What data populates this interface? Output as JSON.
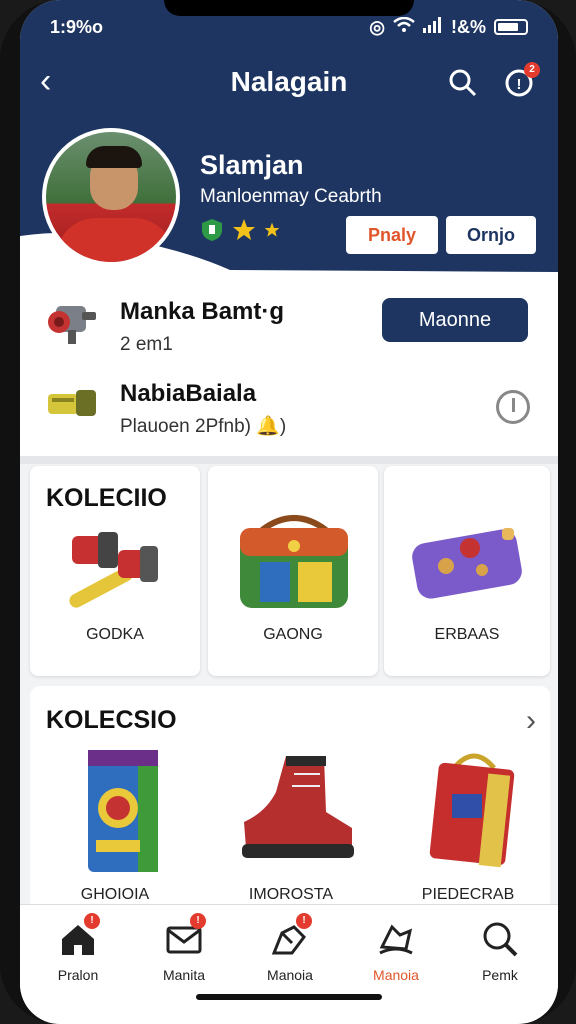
{
  "status": {
    "time": "1:9%o",
    "signal_text": "!&%"
  },
  "header": {
    "title": "Nalagain"
  },
  "profile": {
    "name": "Slamjan",
    "subtitle": "Manloenmay Ceabrth",
    "play_label": "Pnaly",
    "more_label": "Ornjo"
  },
  "rows": [
    {
      "title": "Manka Bamt·g",
      "sub": "2 em1",
      "button": "Maonne"
    },
    {
      "title": "NabiaBaiala",
      "sub": "Plauoen 2Pfnb) 🔔)"
    }
  ],
  "collection1": {
    "title": "KOLECIIO",
    "items": [
      {
        "label": "GODKA"
      },
      {
        "label": "GAONG"
      },
      {
        "label": "ERBAAS"
      }
    ]
  },
  "collection2": {
    "title": "KOLECSIO",
    "items": [
      {
        "label": "GHOIOIA"
      },
      {
        "label": "IMOROSTA"
      },
      {
        "label": "PIEDECRAB"
      }
    ]
  },
  "tabs": [
    {
      "label": "Pralon",
      "icon": "home-icon"
    },
    {
      "label": "Manita",
      "icon": "mail-icon"
    },
    {
      "label": "Manoia",
      "icon": "flag-icon"
    },
    {
      "label": "Manoia",
      "icon": "ship-icon"
    },
    {
      "label": "Pemk",
      "icon": "search-icon"
    }
  ],
  "colors": {
    "primary": "#1d3560",
    "accent": "#e0562b",
    "badge": "#e33b2e"
  }
}
